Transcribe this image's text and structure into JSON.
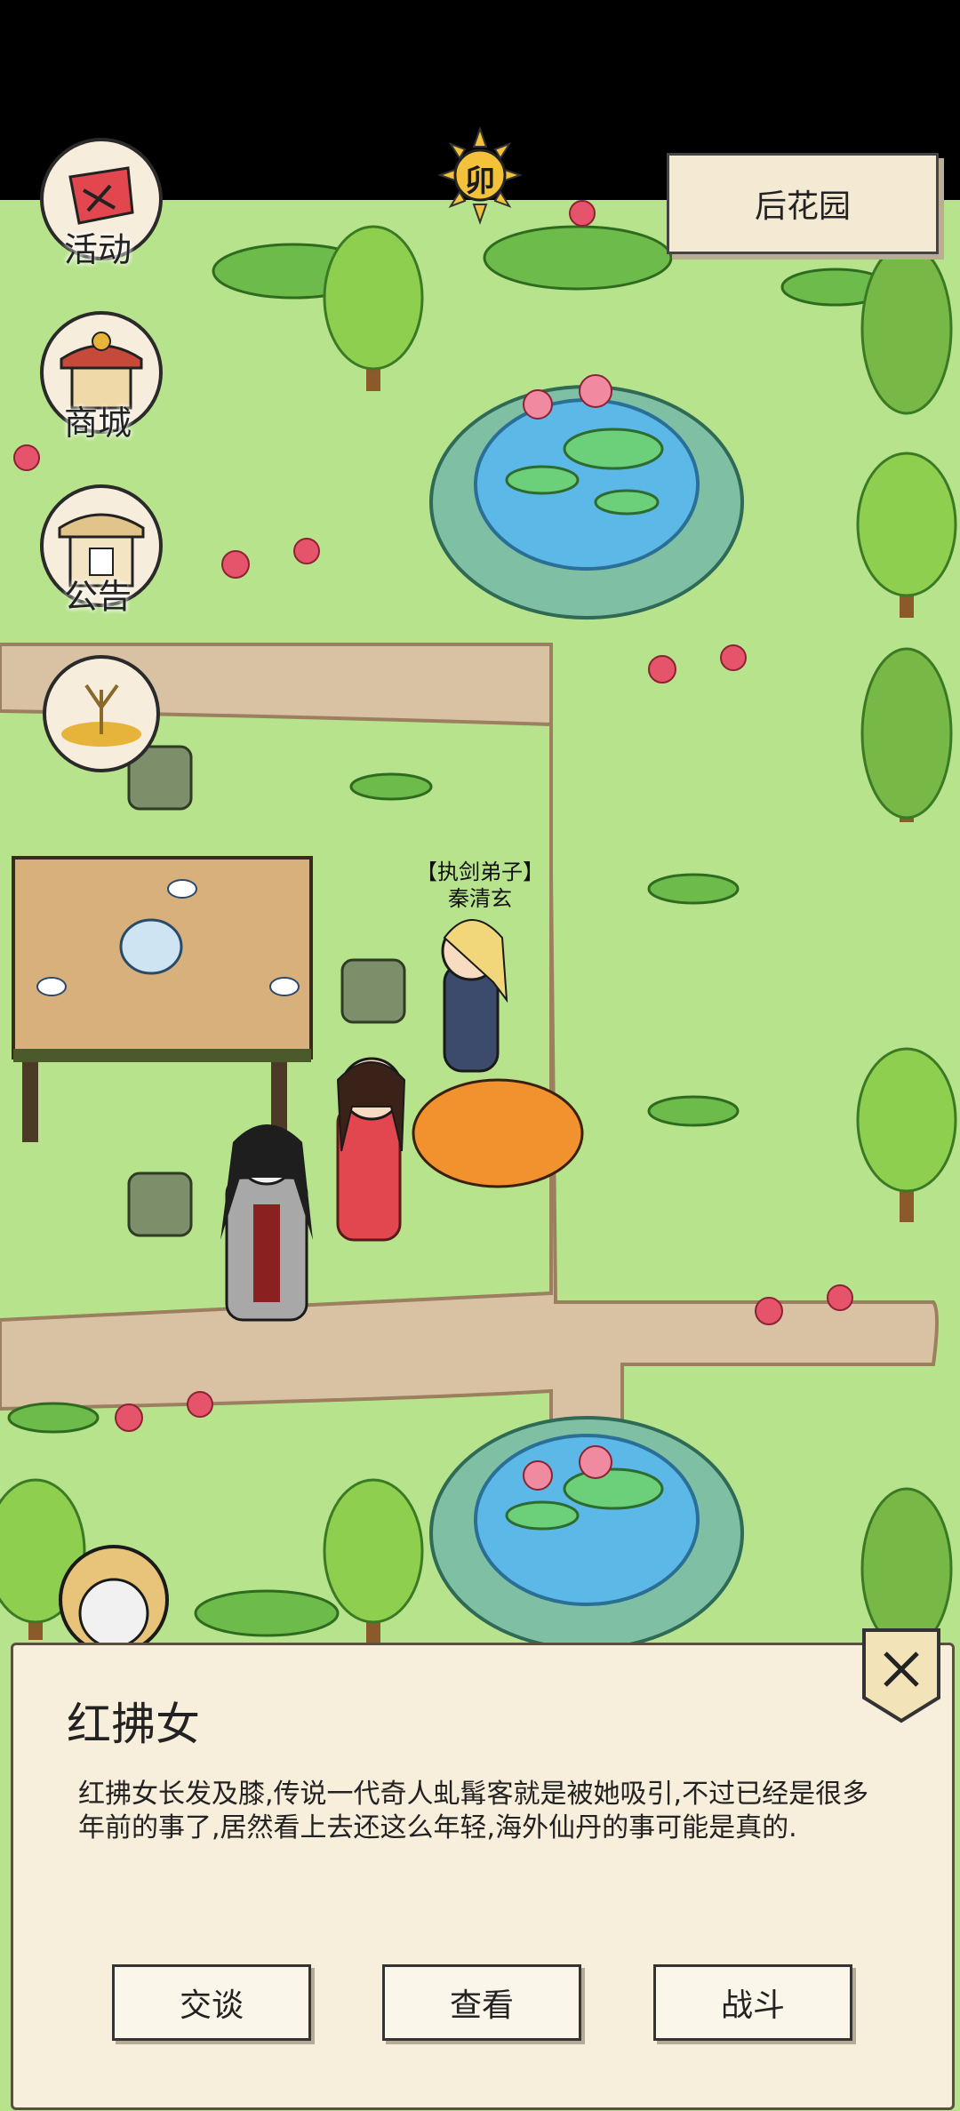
{
  "menu": {
    "event_label": "活动",
    "shop_label": "商城",
    "notice_label": "公告"
  },
  "time": {
    "hour_char": "卯"
  },
  "location": {
    "name": "后花园"
  },
  "npc_tag": {
    "title": "【执剑弟子】",
    "name": "秦清玄"
  },
  "dialog": {
    "name": "红拂女",
    "description": "红拂女长发及膝,传说一代奇人虬髯客就是被她吸引,不过已经是很多年前的事了,居然看上去还这么年轻,海外仙丹的事可能是真的.",
    "talk_label": "交谈",
    "view_label": "查看",
    "fight_label": "战斗"
  },
  "colors": {
    "grass": "#b7e38c",
    "path": "#d8c2a3",
    "panel": "#f7eedb",
    "water": "#5cb8e6"
  }
}
